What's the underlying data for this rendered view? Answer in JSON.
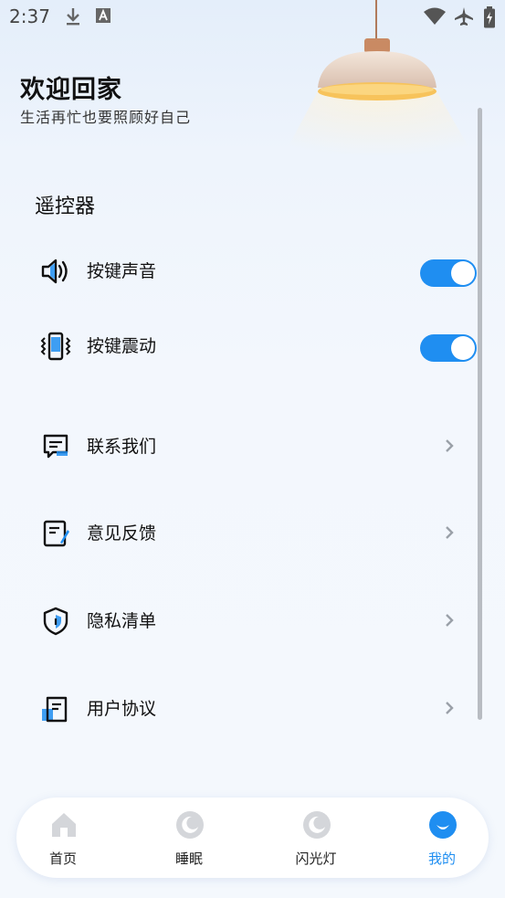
{
  "status_bar": {
    "time": "2:37",
    "icons": [
      "download-icon",
      "font-a-icon",
      "wifi-icon",
      "airplane-icon",
      "battery-charging-icon"
    ]
  },
  "header": {
    "title": "欢迎回家",
    "subtitle": "生活再忙也要照顾好自己"
  },
  "remote": {
    "section_title": "遥控器",
    "items": [
      {
        "label": "按键声音",
        "icon": "speaker-icon",
        "enabled": true
      },
      {
        "label": "按键震动",
        "icon": "vibrate-icon",
        "enabled": true
      }
    ]
  },
  "menu": [
    {
      "label": "联系我们",
      "icon": "message-icon"
    },
    {
      "label": "意见反馈",
      "icon": "feedback-icon"
    },
    {
      "label": "隐私清单",
      "icon": "shield-icon"
    },
    {
      "label": "用户协议",
      "icon": "document-icon"
    }
  ],
  "tabbar": [
    {
      "label": "首页",
      "icon": "home-icon",
      "active": false
    },
    {
      "label": "睡眠",
      "icon": "moon-icon",
      "active": false
    },
    {
      "label": "闪光灯",
      "icon": "moon-icon",
      "active": false
    },
    {
      "label": "我的",
      "icon": "smile-icon",
      "active": true
    }
  ],
  "colors": {
    "accent": "#1f8ef1",
    "toggle_on": "#1f8ef1",
    "inactive_icon": "#d4d6da"
  }
}
